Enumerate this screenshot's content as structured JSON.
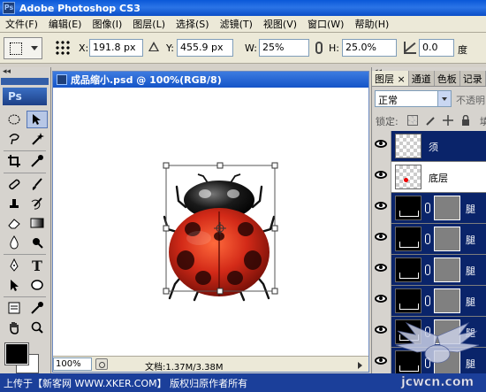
{
  "app": {
    "title": "Adobe Photoshop CS3",
    "logo_text": "Ps"
  },
  "menu": [
    "文件(F)",
    "编辑(E)",
    "图像(I)",
    "图层(L)",
    "选择(S)",
    "滤镜(T)",
    "视图(V)",
    "窗口(W)",
    "帮助(H)"
  ],
  "options": {
    "x_label": "X:",
    "x_value": "191.8 px",
    "y_label": "Y:",
    "y_value": "455.9 px",
    "w_label": "W:",
    "w_value": "25%",
    "h_label": "H:",
    "h_value": "25.0%",
    "angle_value": "0.0",
    "angle_unit": "度"
  },
  "toolbox": {
    "collapse": "◂◂",
    "logo": "Ps"
  },
  "document": {
    "title": "成品缩小.psd @ 100%(RGB/8)",
    "zoom": "100%",
    "doc_info": "文档:1.37M/3.38M"
  },
  "layers_panel": {
    "collapse": "◂◂",
    "tabs": [
      "图层 ×",
      "通道",
      "色板",
      "记录"
    ],
    "blend_mode": "正常",
    "opacity_label": "不透明",
    "lock_label": "锁定:",
    "fill_label": "填",
    "layers": [
      {
        "name": "须",
        "selected": true,
        "thumb": "transparent",
        "mask": false
      },
      {
        "name": "底层",
        "selected": false,
        "thumb": "transparent-red-dot",
        "mask": false
      },
      {
        "name": "腿",
        "selected": true,
        "thumb": "dark",
        "mask": true
      },
      {
        "name": "腿",
        "selected": true,
        "thumb": "dark",
        "mask": true
      },
      {
        "name": "腿",
        "selected": true,
        "thumb": "dark",
        "mask": true
      },
      {
        "name": "腿",
        "selected": true,
        "thumb": "dark",
        "mask": true
      },
      {
        "name": "腿",
        "selected": true,
        "thumb": "dark",
        "mask": true
      },
      {
        "name": "腿",
        "selected": true,
        "thumb": "dark",
        "mask": true
      }
    ]
  },
  "footer": {
    "text": "上传于【新客网 WWW.XKER.COM】 版权归原作者所有"
  },
  "watermark": {
    "text": "jcwcn.com"
  },
  "colors": {
    "title_blue": "#0a58d8",
    "selected_layer": "#0a246a",
    "ladybug_red": "#c8231a"
  }
}
